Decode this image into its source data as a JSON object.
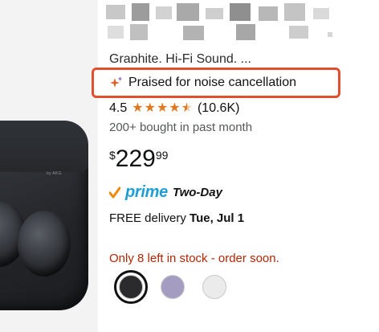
{
  "product": {
    "title_partial": "Graphite, Hi-Fi Sound, ...",
    "highlight_badge": "Praised for noise cancellation",
    "rating": "4.5",
    "rating_value": 4.5,
    "review_count": "(10.6K)",
    "bought_text": "200+ bought in past month",
    "price": {
      "symbol": "$",
      "whole": "229",
      "fraction": "99"
    },
    "shipping": {
      "prime_label": "prime",
      "speed_label": "Two-Day"
    },
    "delivery": {
      "prefix": "FREE delivery ",
      "date": "Tue, Jul 1"
    },
    "stock_text": "Only 8 left in stock - order soon.",
    "case_brand": "by AKG"
  },
  "colors": {
    "highlight_border": "#e0502e",
    "star": "#de7921",
    "prime_blue": "#1f9ed6",
    "stock_red": "#b12704",
    "swatches": [
      "#2b2b2e",
      "#a59cc2",
      "#ebebeb"
    ]
  },
  "swatches": [
    {
      "name": "graphite",
      "color": "#2b2b2e",
      "selected": true
    },
    {
      "name": "bora-purple",
      "color": "#a59cc2",
      "selected": false
    },
    {
      "name": "white",
      "color": "#ebebeb",
      "selected": false
    }
  ],
  "icons": {
    "badge": "sparkle-icon",
    "prime": "prime-check-icon",
    "rating": "star-icon"
  }
}
